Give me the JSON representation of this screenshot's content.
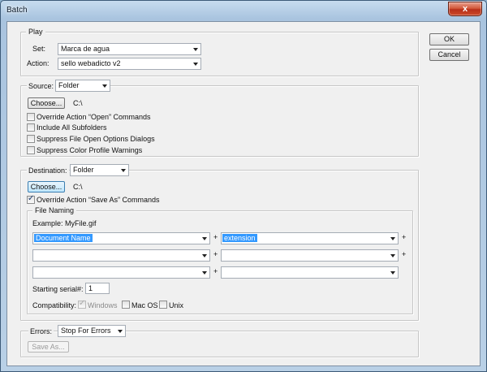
{
  "window": {
    "title": "Batch",
    "close_glyph": "x"
  },
  "buttons": {
    "ok": "OK",
    "cancel": "Cancel"
  },
  "play": {
    "legend": "Play",
    "set_label": "Set:",
    "set_value": "Marca de agua",
    "action_label": "Action:",
    "action_value": "sello webadicto v2"
  },
  "source": {
    "label": "Source:",
    "value": "Folder",
    "choose_label": "Choose...",
    "path": "C:\\",
    "options": [
      {
        "label": "Override Action “Open” Commands",
        "checked": false
      },
      {
        "label": "Include All Subfolders",
        "checked": false
      },
      {
        "label": "Suppress File Open Options Dialogs",
        "checked": false
      },
      {
        "label": "Suppress Color Profile Warnings",
        "checked": false
      }
    ]
  },
  "destination": {
    "label": "Destination:",
    "value": "Folder",
    "choose_label": "Choose...",
    "path": "C:\\",
    "override_label": "Override Action “Save As” Commands",
    "override_checked": true,
    "file_naming": {
      "legend": "File Naming",
      "example": "Example: MyFile.gif",
      "fields": [
        [
          "Document Name",
          "extension"
        ],
        [
          "",
          ""
        ],
        [
          "",
          ""
        ]
      ],
      "plus": "+",
      "serial_label": "Starting serial#:",
      "serial_value": "1",
      "compat_label": "Compatibility:",
      "compat": [
        {
          "label": "Windows",
          "checked": true,
          "disabled": true
        },
        {
          "label": "Mac OS",
          "checked": false,
          "disabled": false
        },
        {
          "label": "Unix",
          "checked": false,
          "disabled": false
        }
      ]
    }
  },
  "errors": {
    "label": "Errors:",
    "value": "Stop For Errors",
    "save_as_label": "Save As..."
  }
}
